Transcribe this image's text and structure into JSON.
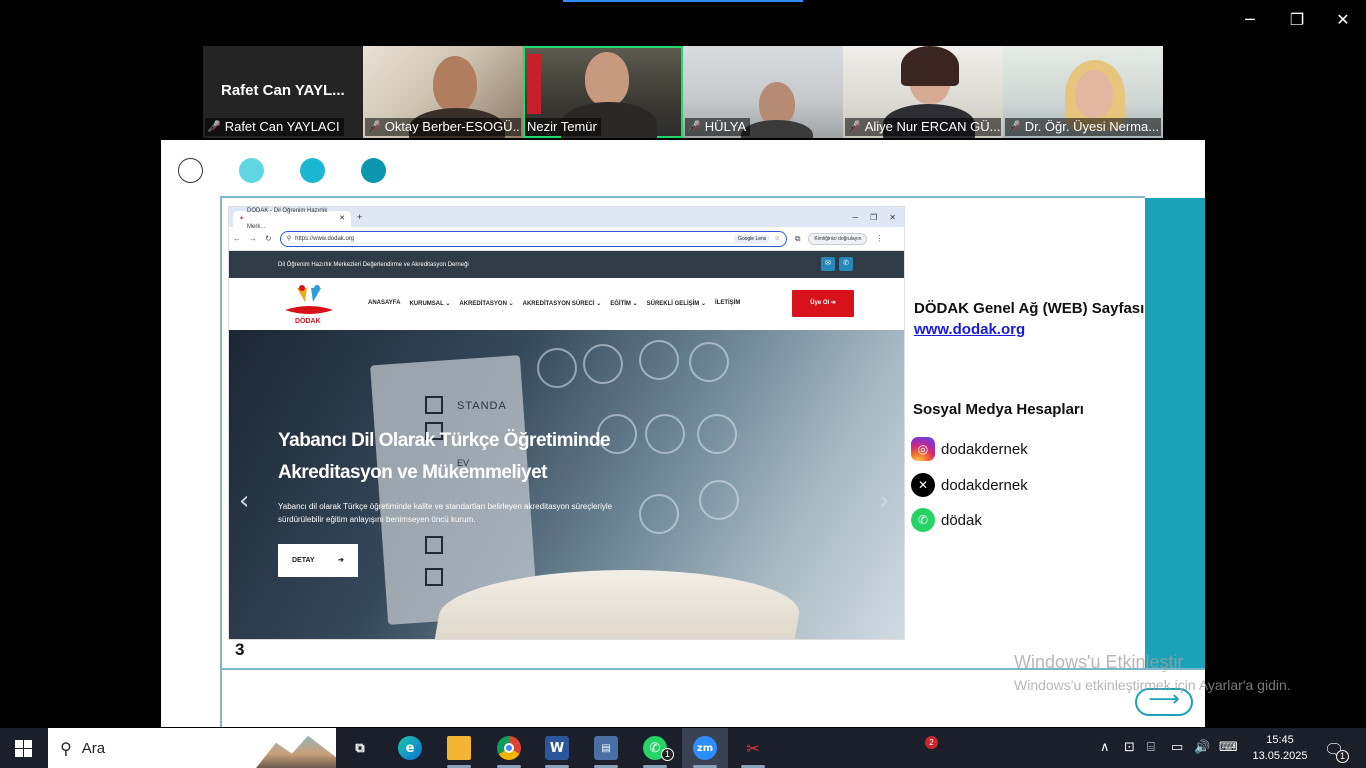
{
  "window": {
    "minimize_glyph": "─",
    "restore_glyph": "❐",
    "close_glyph": "✕"
  },
  "participants": [
    {
      "display": "Rafet Can YAYL...",
      "name": "Rafet Can YAYLACI",
      "video": false,
      "muted": true
    },
    {
      "name": "Oktay Berber-ESOGÜ...",
      "video": true,
      "muted": true
    },
    {
      "name": "Nezir Temür",
      "video": true,
      "muted": false,
      "active_speaker": true
    },
    {
      "name": "HÜLYA",
      "video": true,
      "muted": true
    },
    {
      "name": "Aliye Nur ERCAN GÜ...",
      "video": true,
      "muted": true
    },
    {
      "name": "Dr. Öğr. Üyesi Nerma...",
      "video": true,
      "muted": true
    }
  ],
  "slide": {
    "number": "3",
    "dot_colors": [
      "#5fd6e2",
      "#1bb8d4",
      "#0c97b0"
    ],
    "accent_color": "#1aa3b8",
    "browser": {
      "tab_title": "DÖDAK - Dil Öğrenim Hazırlık Merk...",
      "url": "https://www.dodak.org",
      "lens_label": "Google Lens",
      "verify_label": "Kimliğinizi doğrulayın",
      "site_top_text": "Dil Öğrenim Hazırlık Merkezleri Değerlendirme ve Akreditasyon Derneği",
      "logo_text": "DÖDAK",
      "nav": [
        "ANASAYFA",
        "KURUMSAL ⌄",
        "AKREDİTASYON ⌄",
        "AKREDİTASYON SÜRECİ ⌄",
        "EĞİTİM ⌄",
        "SÜREKLİ GELİŞİM ⌄",
        "İLETİŞİM"
      ],
      "cta": "Üye Ol ➔",
      "hero_title": "Yabancı Dil Olarak Türkçe Öğretiminde Akreditasyon ve Mükemmeliyet",
      "hero_subtitle": "Yabancı dil olarak Türkçe öğretiminde kalite ve standartları belirleyen akreditasyon süreçleriyle sürdürülebilir eğitim anlayışını benimseyen öncü kurum.",
      "hero_button": "DETAY",
      "hero_button_arrow": "➔",
      "hero_board_text": "STANDA",
      "hero_board_text2": "EV"
    },
    "info_title": "DÖDAK Genel Ağ (WEB) Sayfası",
    "info_link": "www.dodak.org",
    "social_title": "Sosyal Medya Hesapları",
    "social": [
      {
        "platform": "instagram",
        "icon": "instagram-icon",
        "handle": "dodakdernek"
      },
      {
        "platform": "x",
        "icon": "x-icon",
        "handle": "dodakdernek"
      },
      {
        "platform": "whatsapp",
        "icon": "whatsapp-icon",
        "handle": "dödak"
      }
    ]
  },
  "watermark": {
    "line1": "Windows'u Etkinleştir",
    "line2": "Windows'u etkinleştirmek için Ayarlar'a gidin."
  },
  "taskbar": {
    "search_placeholder": "Ara",
    "whatsapp_badge": "1",
    "notification_badge": "2",
    "action_center_badge": "1",
    "time": "15:45",
    "date": "13.05.2025"
  }
}
